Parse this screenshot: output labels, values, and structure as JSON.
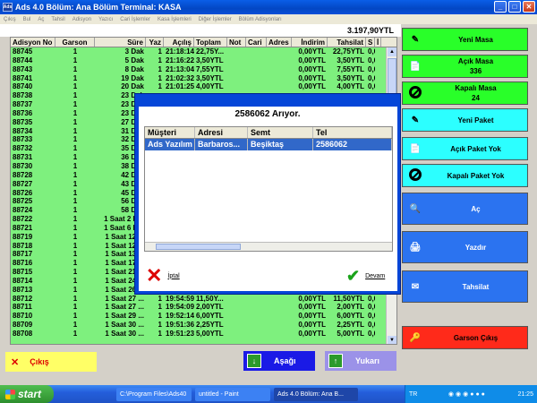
{
  "window": {
    "title": "Ads 4.0 Bölüm: Ana Bölüm Terminal: KASA",
    "app_icon": "Ads",
    "btn_min": "_",
    "btn_max": "□",
    "btn_close": "✕"
  },
  "menu": [
    "Çıkış",
    "Bul",
    "Aç",
    "Tahsil",
    "Adisyon",
    "Yazıcı",
    "Cari İşlemler",
    "Kasa İşlemleri",
    "Diğer İşlemler",
    "Bölüm Adisyonları"
  ],
  "total": "3.197,90YTL",
  "grid": {
    "headers": [
      "Adisyon No",
      "Garson",
      "Süre",
      "Yaz",
      "Açılış",
      "Toplam",
      "Not",
      "Cari",
      "Adres",
      "İndirim",
      "Tahsilat",
      "S",
      "İ"
    ],
    "rows": [
      [
        "88745",
        "1",
        "3 Dak",
        "1",
        "21:18:14",
        "22,75Y...",
        "",
        "",
        "",
        "0,00YTL",
        "22,75YTL",
        "0,00",
        ""
      ],
      [
        "88744",
        "1",
        "5 Dak",
        "1",
        "21:16:22",
        "3,50YTL",
        "",
        "",
        "",
        "0,00YTL",
        "3,50YTL",
        "0,00",
        ""
      ],
      [
        "88743",
        "1",
        "8 Dak",
        "1",
        "21:13:04",
        "7,55YTL",
        "",
        "",
        "",
        "0,00YTL",
        "7,55YTL",
        "0,00",
        ""
      ],
      [
        "88741",
        "1",
        "19 Dak",
        "1",
        "21:02:32",
        "3,50YTL",
        "",
        "",
        "",
        "0,00YTL",
        "3,50YTL",
        "0,00",
        ""
      ],
      [
        "88740",
        "1",
        "20 Dak",
        "1",
        "21:01:25",
        "4,00YTL",
        "",
        "",
        "",
        "0,00YTL",
        "4,00YTL",
        "0,00",
        ""
      ],
      [
        "88738",
        "1",
        "23 Dak",
        "",
        "",
        "",
        "",
        "",
        "",
        "",
        "",
        "",
        ""
      ],
      [
        "88737",
        "1",
        "23 Dak",
        "",
        "",
        "",
        "",
        "",
        "",
        "",
        "",
        "",
        ""
      ],
      [
        "88736",
        "1",
        "23 Dak",
        "",
        "",
        "",
        "",
        "",
        "",
        "",
        "",
        "",
        ""
      ],
      [
        "88735",
        "1",
        "27 Dak",
        "",
        "",
        "",
        "",
        "",
        "",
        "",
        "",
        "",
        ""
      ],
      [
        "88734",
        "1",
        "31 Dak",
        "",
        "",
        "",
        "",
        "",
        "",
        "",
        "",
        "",
        ""
      ],
      [
        "88733",
        "1",
        "32 Dak",
        "",
        "",
        "",
        "",
        "",
        "",
        "",
        "",
        "",
        ""
      ],
      [
        "88732",
        "1",
        "35 Dak",
        "",
        "",
        "",
        "",
        "",
        "",
        "",
        "",
        "",
        ""
      ],
      [
        "88731",
        "1",
        "36 Dak",
        "",
        "",
        "",
        "",
        "",
        "",
        "",
        "",
        "",
        ""
      ],
      [
        "88730",
        "1",
        "38 Dak",
        "",
        "",
        "",
        "",
        "",
        "",
        "",
        "",
        "",
        ""
      ],
      [
        "88728",
        "1",
        "42 Dak",
        "",
        "",
        "",
        "",
        "",
        "",
        "",
        "",
        "",
        ""
      ],
      [
        "88727",
        "1",
        "43 Dak",
        "",
        "",
        "",
        "",
        "",
        "",
        "",
        "",
        "",
        ""
      ],
      [
        "88726",
        "1",
        "45 Dak",
        "",
        "",
        "",
        "",
        "",
        "",
        "",
        "",
        "",
        ""
      ],
      [
        "88725",
        "1",
        "56 Dak",
        "",
        "",
        "",
        "",
        "",
        "",
        "",
        "",
        "",
        ""
      ],
      [
        "88724",
        "1",
        "58 Dak",
        "",
        "",
        "",
        "",
        "",
        "",
        "",
        "",
        "",
        ""
      ],
      [
        "88722",
        "1",
        "1 Saat 2 D...",
        "",
        "",
        "",
        "",
        "",
        "",
        "",
        "",
        "",
        ""
      ],
      [
        "88721",
        "1",
        "1 Saat 6 D...",
        "",
        "",
        "",
        "",
        "",
        "",
        "",
        "",
        "",
        ""
      ],
      [
        "88719",
        "1",
        "1 Saat 12 ...",
        "",
        "",
        "",
        "",
        "",
        "",
        "",
        "",
        "",
        ""
      ],
      [
        "88718",
        "1",
        "1 Saat 12 ...",
        "",
        "",
        "",
        "",
        "",
        "",
        "",
        "",
        "",
        ""
      ],
      [
        "88717",
        "1",
        "1 Saat 13 ...",
        "",
        "",
        "",
        "",
        "",
        "",
        "",
        "",
        "",
        ""
      ],
      [
        "88716",
        "1",
        "1 Saat 17 ...",
        "",
        "",
        "",
        "",
        "",
        "",
        "",
        "",
        "",
        ""
      ],
      [
        "88715",
        "1",
        "1 Saat 21 ...",
        "",
        "",
        "",
        "",
        "",
        "",
        "",
        "",
        "",
        ""
      ],
      [
        "88714",
        "1",
        "1 Saat 24 ...",
        "",
        "",
        "",
        "",
        "",
        "",
        "",
        "",
        "",
        ""
      ],
      [
        "88713",
        "1",
        "1 Saat 26 ...",
        "",
        "",
        "",
        "",
        "",
        "",
        "",
        "",
        "",
        ""
      ],
      [
        "88712",
        "1",
        "1 Saat 27 ...",
        "1",
        "19:54:59",
        "11,50Y...",
        "",
        "",
        "",
        "0,00YTL",
        "11,50YTL",
        "0,00",
        ""
      ],
      [
        "88711",
        "1",
        "1 Saat 27 ...",
        "1",
        "19:54:09",
        "2,00YTL",
        "",
        "",
        "",
        "0,00YTL",
        "2,00YTL",
        "0,00",
        ""
      ],
      [
        "88710",
        "1",
        "1 Saat 29 ...",
        "1",
        "19:52:14",
        "6,00YTL",
        "",
        "",
        "",
        "0,00YTL",
        "6,00YTL",
        "0,00",
        ""
      ],
      [
        "88709",
        "1",
        "1 Saat 30 ...",
        "1",
        "19:51:36",
        "2,25YTL",
        "",
        "",
        "",
        "0,00YTL",
        "2,25YTL",
        "0,00",
        ""
      ],
      [
        "88708",
        "1",
        "1 Saat 30 ...",
        "1",
        "19:51:23",
        "5,00YTL",
        "",
        "",
        "",
        "0,00YTL",
        "5,00YTL",
        "0,00",
        ""
      ]
    ]
  },
  "right_buttons": [
    {
      "label": "Yeni Masa",
      "sub": "",
      "color": "#29ff29",
      "icon": "✎",
      "name": "yeni-masa-button",
      "icon_name": "new-table-icon"
    },
    {
      "label": "Açık Masa",
      "sub": "336",
      "color": "#29ff29",
      "icon": "📄",
      "name": "acik-masa-button",
      "icon_name": "document-icon"
    },
    {
      "label": "Kapalı Masa",
      "sub": "24",
      "color": "#29ff29",
      "icon": "stop",
      "name": "kapali-masa-button",
      "icon_name": "no-entry-icon"
    },
    {
      "label": "Yeni Paket",
      "sub": "",
      "color": "#2cffff",
      "icon": "✎",
      "name": "yeni-paket-button",
      "icon_name": "new-package-icon"
    },
    {
      "label": "Açık Paket Yok",
      "sub": "",
      "color": "#2cffff",
      "icon": "📄",
      "name": "acik-paket-button",
      "icon_name": "document-icon"
    },
    {
      "label": "Kapalı Paket Yok",
      "sub": "",
      "color": "#2cffff",
      "icon": "stop",
      "name": "kapali-paket-button",
      "icon_name": "no-entry-icon"
    },
    {
      "label": "Aç",
      "sub": "",
      "color": "#2b73f0",
      "icon": "🔍",
      "name": "ac-button",
      "icon_name": "open-icon"
    },
    {
      "label": "Yazdır",
      "sub": "",
      "color": "#2b73f0",
      "icon": "🖨",
      "name": "yazdir-button",
      "icon_name": "printer-icon"
    },
    {
      "label": "Tahsilat",
      "sub": "",
      "color": "#2b73f0",
      "icon": "✉",
      "name": "tahsilat-button",
      "icon_name": "payment-icon"
    },
    {
      "label": "Garson Çıkış",
      "sub": "",
      "color": "#ff2a1a",
      "icon": "🔑",
      "name": "garson-cikis-button",
      "icon_name": "waiter-key-icon"
    }
  ],
  "bottom": {
    "exit": "Çıkış",
    "down": "Aşağı",
    "up": "Yukarı"
  },
  "dialog": {
    "title": "2586062 Arıyor.",
    "headers": [
      "Müşteri",
      "Adresi",
      "Semt",
      "Tel"
    ],
    "row": [
      "Ads Yazılım",
      "Barbaros...",
      "Beşiktaş",
      "2586062"
    ],
    "cancel": "İptal",
    "continue": "Devam"
  },
  "taskbar": {
    "start": "start",
    "items": [
      "C:\\Program Files\\Ads40",
      "untitled - Paint",
      "Ads 4.0 Bölüm: Ana B..."
    ],
    "lang": "TR",
    "time": "21:25"
  }
}
